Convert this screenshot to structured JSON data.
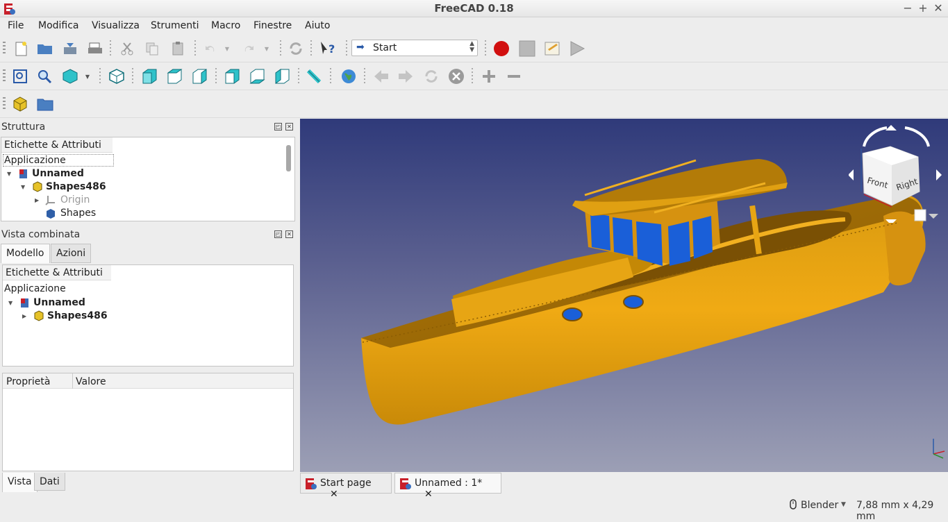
{
  "window": {
    "title": "FreeCAD 0.18",
    "minimize": "−",
    "maximize": "+",
    "close": "✕"
  },
  "menu": [
    "File",
    "Modifica",
    "Visualizza",
    "Strumenti",
    "Macro",
    "Finestre",
    "Aiuto"
  ],
  "workbench": {
    "selected": "Start"
  },
  "tree_panel": {
    "title": "Struttura",
    "header": "Etichette & Attributi",
    "root": "Applicazione",
    "items": [
      {
        "label": "Unnamed"
      },
      {
        "label": "Shapes486"
      },
      {
        "label": "Origin"
      },
      {
        "label": "Shapes"
      }
    ]
  },
  "combo_panel": {
    "title": "Vista combinata",
    "tabs": [
      "Modello",
      "Azioni"
    ],
    "header": "Etichette & Attributi",
    "root": "Applicazione",
    "items": [
      {
        "label": "Unnamed"
      },
      {
        "label": "Shapes486"
      }
    ],
    "property_columns": [
      "Proprietà",
      "Valore"
    ],
    "bottom_tabs": [
      "Vista",
      "Dati"
    ]
  },
  "navcube": {
    "front": "Front",
    "right": "Right"
  },
  "doc_tabs": [
    {
      "label": "Start page",
      "close": "✕"
    },
    {
      "label": "Unnamed : 1*",
      "close": "✕"
    }
  ],
  "status": {
    "nav_style": "Blender",
    "dimensions": "7,88 mm x 4,29 mm"
  },
  "colors": {
    "hull": "#e8a612",
    "glass": "#1a5fd8",
    "bg_top": "#2f3a7a",
    "bg_bottom": "#9c9fb5"
  }
}
